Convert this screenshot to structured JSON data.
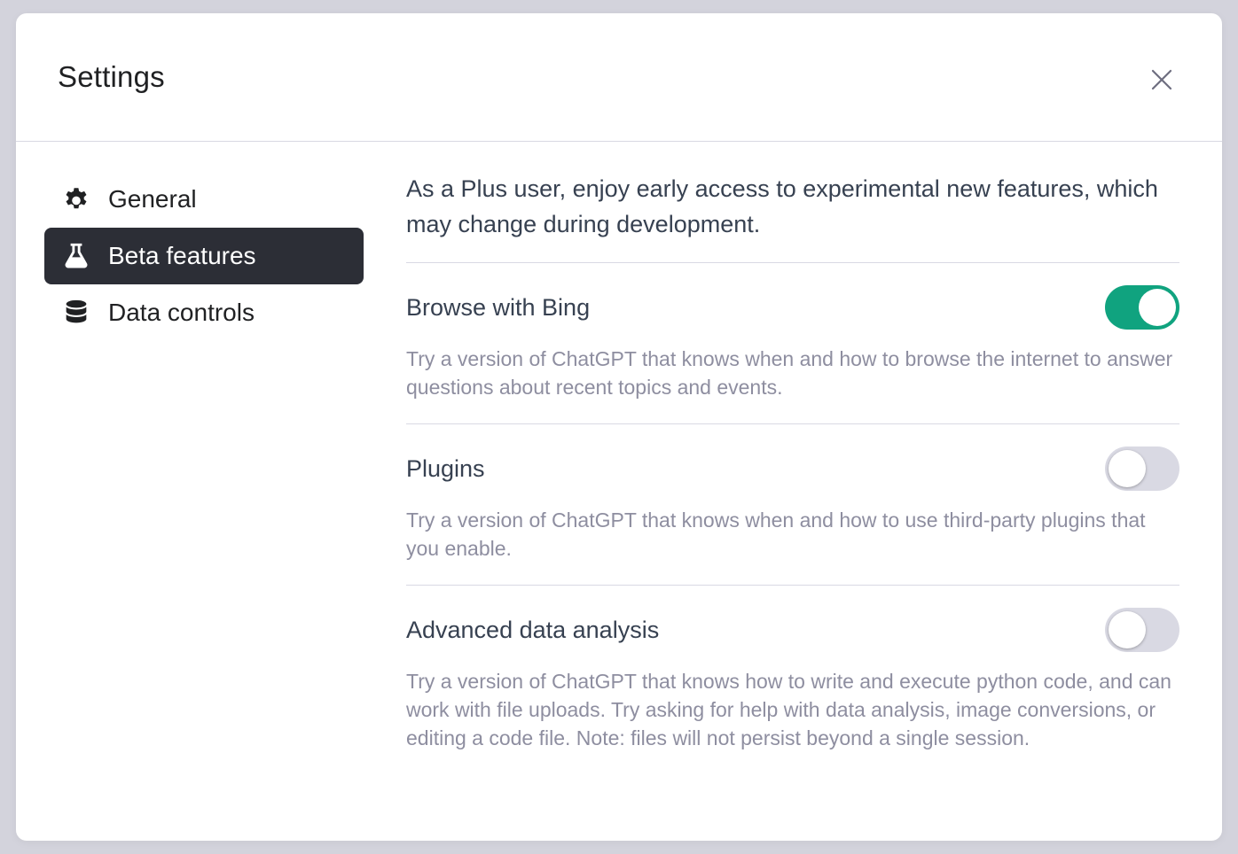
{
  "dialog": {
    "title": "Settings",
    "close_icon": "close-icon"
  },
  "sidebar": {
    "items": [
      {
        "label": "General",
        "icon": "gear-icon",
        "active": false
      },
      {
        "label": "Beta features",
        "icon": "flask-icon",
        "active": true
      },
      {
        "label": "Data controls",
        "icon": "database-icon",
        "active": false
      }
    ]
  },
  "content": {
    "intro": "As a Plus user, enjoy early access to experimental new features, which may change during development.",
    "features": [
      {
        "name": "Browse with Bing",
        "description": "Try a version of ChatGPT that knows when and how to browse the internet to answer questions about recent topics and events.",
        "enabled": true
      },
      {
        "name": "Plugins",
        "description": "Try a version of ChatGPT that knows when and how to use third-party plugins that you enable.",
        "enabled": false
      },
      {
        "name": "Advanced data analysis",
        "description": "Try a version of ChatGPT that knows how to write and execute python code, and can work with file uploads. Try asking for help with data analysis, image conversions, or editing a code file. Note: files will not persist beyond a single session.",
        "enabled": false
      }
    ]
  },
  "colors": {
    "toggle_on": "#10a37f",
    "toggle_off": "#d9d9e3",
    "active_nav_bg": "#2c2e36"
  }
}
